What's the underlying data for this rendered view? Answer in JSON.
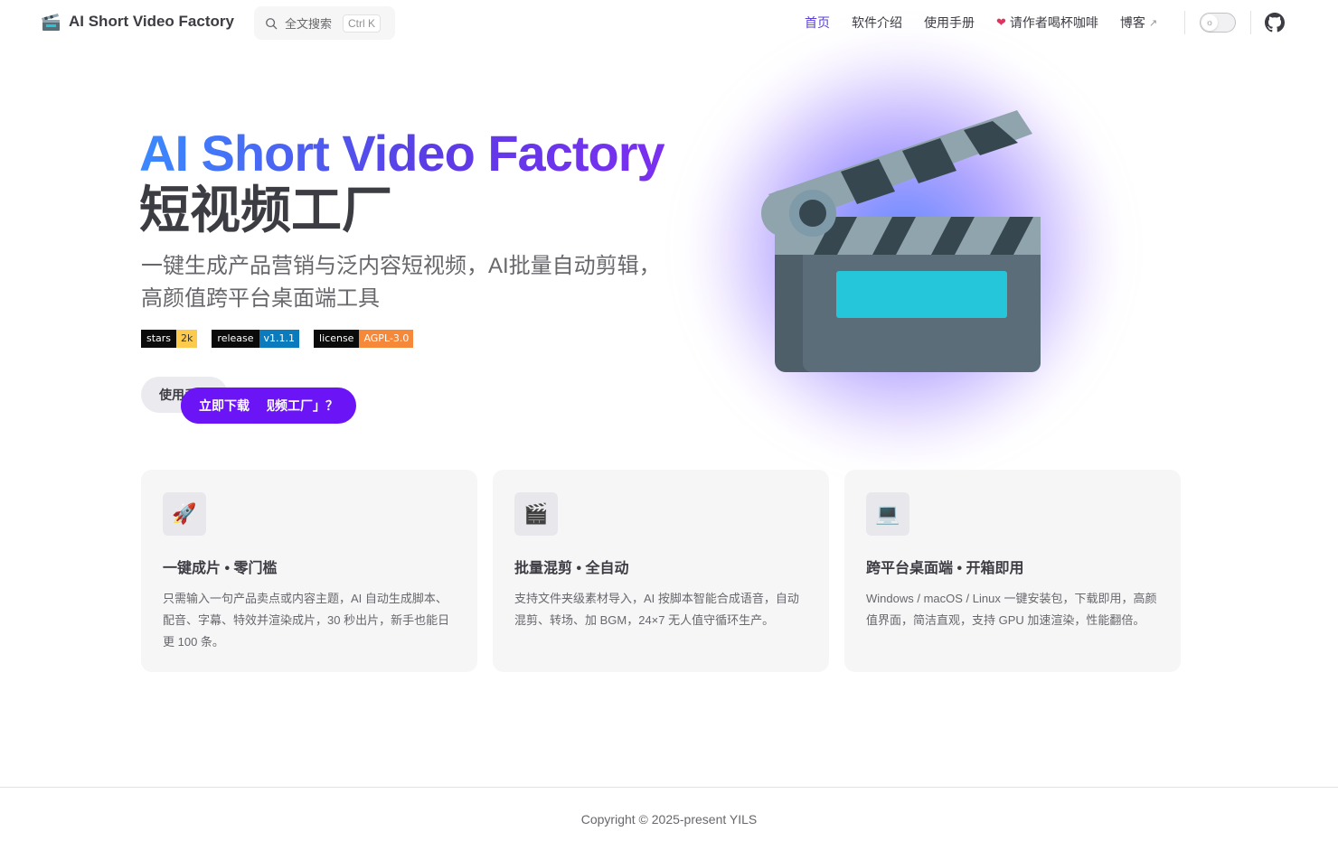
{
  "nav": {
    "brand_title": "AI Short Video Factory",
    "brand_icon": "clapper-board-icon",
    "search_placeholder": "全文搜索",
    "search_shortcut": "Ctrl K",
    "menu": [
      {
        "label": "首页",
        "active": true
      },
      {
        "label": "软件介绍"
      },
      {
        "label": "使用手册"
      },
      {
        "label": "请作者喝杯咖啡",
        "icon": "heart-icon"
      },
      {
        "label": "博客",
        "external": true
      }
    ],
    "theme_toggle_icon": "sun-icon",
    "github_icon": "github-icon"
  },
  "hero": {
    "name": "AI Short Video Factory",
    "text": "短视频工厂",
    "tagline": "一键生成产品营销与泛内容短视频，AI批量自动剪辑，高颜值跨平台桌面端工具",
    "badges": [
      {
        "key": "stars",
        "value": "2k",
        "color": "#fccb4d",
        "text_color": "#333333"
      },
      {
        "key": "release",
        "value": "v1.1.1",
        "color": "#0a7bbd"
      },
      {
        "key": "license",
        "value": "AGPL-3.0",
        "color": "#f6883a"
      }
    ],
    "actions": [
      {
        "label": "什么是「短视频工厂」？",
        "theme": "brand"
      },
      {
        "label": "立即下载",
        "theme": "brand"
      },
      {
        "label": "使用手册",
        "theme": "alt"
      }
    ],
    "image_icon": "clapper-board-icon"
  },
  "features": [
    {
      "icon": "🚀",
      "icon_name": "rocket-icon",
      "title": "一键成片 • 零门槛",
      "details": "只需输入一句产品卖点或内容主题，AI 自动生成脚本、配音、字幕、特效并渲染成片，30 秒出片，新手也能日更 100 条。"
    },
    {
      "icon": "🎬",
      "icon_name": "clapper-icon",
      "title": "批量混剪 • 全自动",
      "details": "支持文件夹级素材导入，AI 按脚本智能合成语音，自动混剪、转场、加 BGM，24×7 无人值守循环生产。"
    },
    {
      "icon": "💻",
      "icon_name": "laptop-icon",
      "title": "跨平台桌面端 • 开箱即用",
      "details": "Windows / macOS / Linux 一键安装包，下载即用，高颜值界面，简洁直观，支持 GPU 加速渲染，性能翻倍。"
    }
  ],
  "footer": {
    "copyright": "Copyright © 2025-present YILS"
  },
  "colors": {
    "brand": "#6b14f5",
    "active_nav": "#5b3fd6",
    "gradient_start": "#3a8bff",
    "gradient_end": "#7b2ff0"
  }
}
